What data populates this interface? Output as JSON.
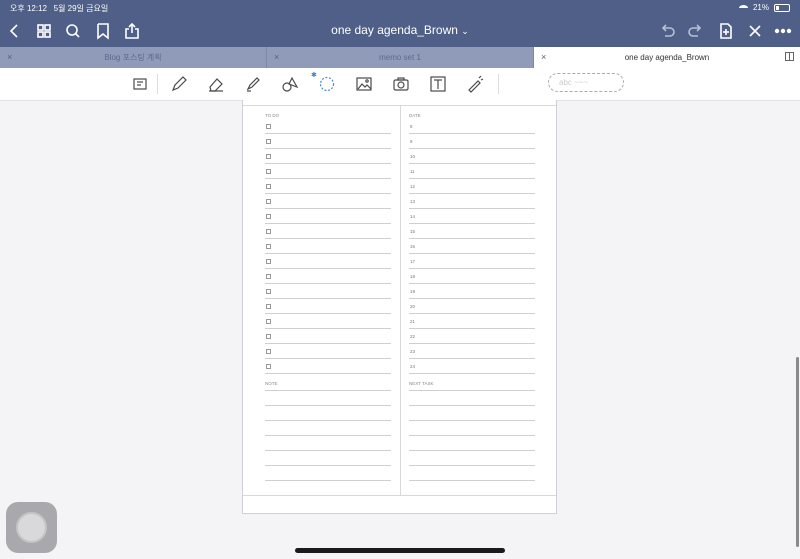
{
  "status_bar": {
    "time": "오후 12:12",
    "date": "5월 29일 금요일",
    "battery": "21%",
    "battery_level": 0.21
  },
  "nav": {
    "title": "one day agenda_Brown",
    "title_chevron": "⌄"
  },
  "tabs": [
    {
      "label": "Blog 포스팅 계획",
      "close": "×"
    },
    {
      "label": "memo set 1",
      "close": "×"
    },
    {
      "label": "one day agenda_Brown",
      "close": "×"
    }
  ],
  "toolbar": {
    "bluetooth": "✱",
    "lasso_text": "abc ~~~"
  },
  "page": {
    "todo_header": "TO DO",
    "date_header": "DATE",
    "notes_header": "NOTE",
    "next_task_header": "NEXT TASK",
    "hours": [
      "8",
      "9",
      "10",
      "11",
      "12",
      "13",
      "14",
      "15",
      "16",
      "17",
      "18",
      "19",
      "20",
      "21",
      "22",
      "23",
      "24"
    ]
  }
}
